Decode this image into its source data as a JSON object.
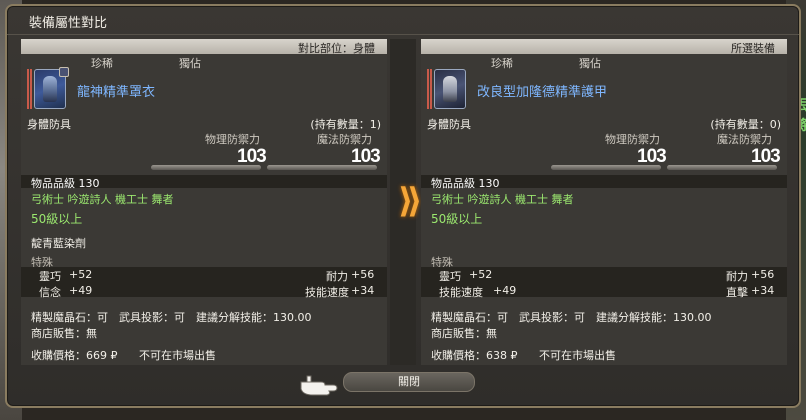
{
  "window": {
    "title": "裝備屬性對比"
  },
  "left": {
    "header": "對比部位：身體",
    "tag_rare": "珍稀",
    "tag_unique": "獨佔",
    "icon": "armor-icon",
    "item_name": "龍神精準罩衣",
    "category": "身體防具",
    "owned": "(持有數量：1)",
    "phys_label": "物理防禦力",
    "mag_label": "魔法防禦力",
    "phys_value": "103",
    "mag_value": "103",
    "item_level": "物品品級 130",
    "jobs": "弓術士 吟遊詩人 機工士 舞者",
    "level": "50級以上",
    "dye": "靛青藍染劑",
    "special_label": "特殊",
    "bonus": [
      {
        "name": "靈巧",
        "value": "+52"
      },
      {
        "name": "耐力",
        "value": "+56"
      },
      {
        "name": "信念",
        "value": "+49"
      },
      {
        "name": "技能速度",
        "value": "+34"
      }
    ],
    "crafting": "精製魔晶石：可　武具投影：可　建議分解技能：130.00",
    "shop": "商店販售：無",
    "sell": "收購價格：669",
    "market": "不可在市場出售"
  },
  "right": {
    "header": "所選裝備",
    "tag_rare": "珍稀",
    "tag_unique": "獨佔",
    "icon": "armor-icon",
    "item_name": "改良型加隆德精準護甲",
    "category": "身體防具",
    "owned": "(持有數量：0)",
    "phys_label": "物理防禦力",
    "mag_label": "魔法防禦力",
    "phys_value": "103",
    "mag_value": "103",
    "item_level": "物品品級 130",
    "jobs": "弓術士 吟遊詩人 機工士 舞者",
    "level": "50級以上",
    "special_label": "特殊",
    "bonus": [
      {
        "name": "靈巧",
        "value": "+52"
      },
      {
        "name": "耐力",
        "value": "+56"
      },
      {
        "name": "技能速度",
        "value": "+49"
      },
      {
        "name": "直擊",
        "value": "+34"
      }
    ],
    "crafting": "精製魔晶石：可　武具投影：可　建議分解技能：130.00",
    "shop": "商店販售：無",
    "sell": "收購價格：638",
    "market": "不可在市場出售"
  },
  "currency_icon": "gil-icon",
  "close_button": "關閉",
  "background_right_text": "丟 將",
  "colors": {
    "item_name": "#7fb7ff",
    "green": "#9be86f",
    "arrow": "#f5a638"
  }
}
